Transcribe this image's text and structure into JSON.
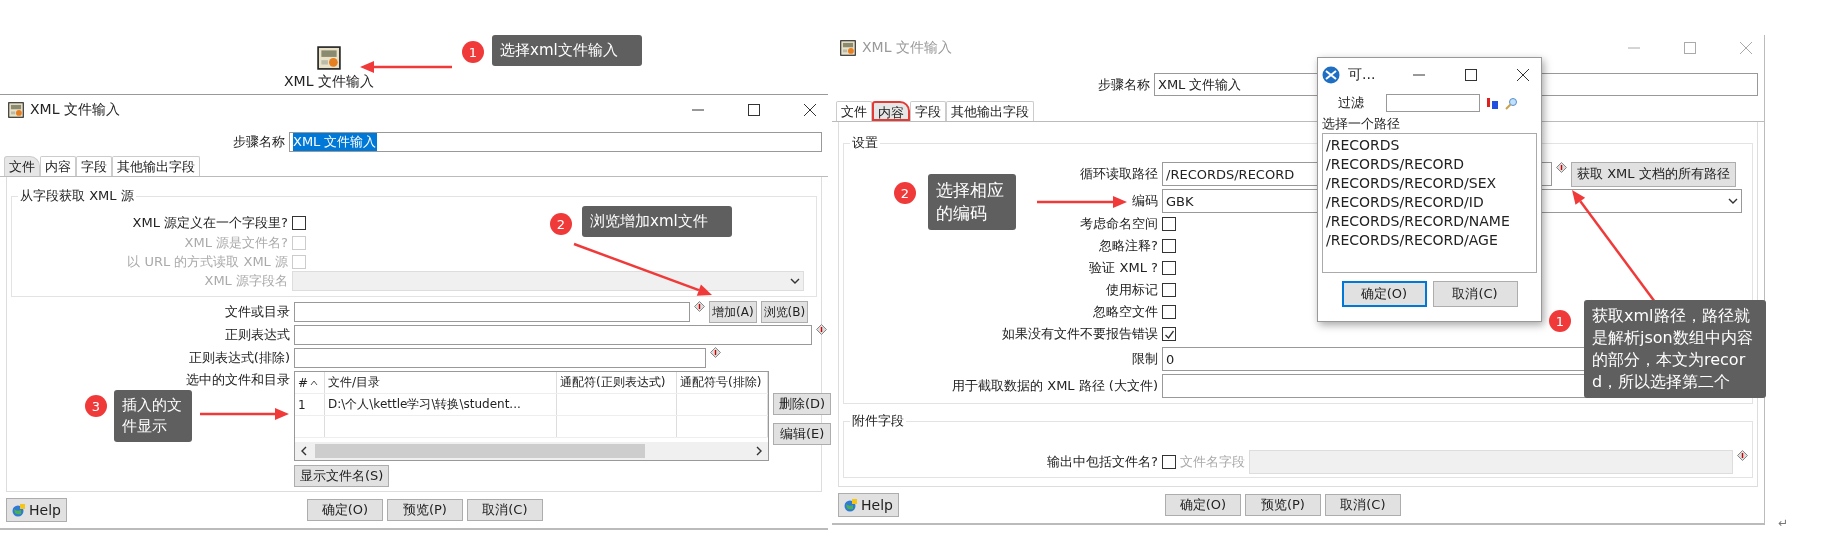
{
  "left": {
    "node": {
      "label": "XML 文件输入"
    },
    "dialog": {
      "title": "XML 文件输入",
      "active": true,
      "step_name": {
        "label": "步骤名称",
        "value": "XML 文件输入",
        "highlighted": true
      },
      "tabs": [
        {
          "label": "文件",
          "selected": true,
          "marked": false
        },
        {
          "label": "内容",
          "selected": false,
          "marked": false
        },
        {
          "label": "字段",
          "selected": false,
          "marked": false
        },
        {
          "label": "其他输出字段",
          "selected": false,
          "marked": false
        }
      ],
      "source_group": {
        "title": "从字段获取 XML 源",
        "options": [
          {
            "label": "XML 源定义在一个字段里?",
            "checked": false,
            "disabled": false
          },
          {
            "label": "XML 源是文件名?",
            "checked": false,
            "disabled": true
          },
          {
            "label": "以 URL 的方式读取 XML 源",
            "checked": false,
            "disabled": true
          }
        ],
        "field": {
          "label": "XML 源字段名",
          "disabled": true
        }
      },
      "file_row": {
        "label": "文件或目录",
        "buttons": [
          "增加(A)",
          "浏览(B)"
        ]
      },
      "regex": {
        "label": "正则表达式"
      },
      "regex_exclude": {
        "label": "正则表达式(排除)"
      },
      "selected_files": {
        "label": "选中的文件和目录",
        "columns": [
          "#",
          "文件/目录",
          "通配符(正则表达式)",
          "通配符号(排除)"
        ],
        "rows": [
          {
            "cells": [
              "1",
              "D:\\个人\\kettle学习\\转换\\student..."
            ]
          }
        ],
        "buttons": [
          "删除(D)",
          "编辑(E)"
        ]
      },
      "show_button": "显示文件名(S)",
      "help": "Help",
      "buttons": [
        "确定(O)",
        "预览(P)",
        "取消(C)"
      ]
    }
  },
  "right": {
    "dialog": {
      "title": "XML 文件输入",
      "active": false,
      "step_name": {
        "label": "步骤名称",
        "value": "XML 文件输入",
        "highlighted": false
      },
      "tabs": [
        {
          "label": "文件",
          "selected": false,
          "marked": false
        },
        {
          "label": "内容",
          "selected": true,
          "marked": true
        },
        {
          "label": "字段",
          "selected": false,
          "marked": false
        },
        {
          "label": "其他输出字段",
          "selected": false,
          "marked": false
        }
      ],
      "settings": {
        "title": "设置",
        "loop_path": {
          "label": "循环读取路径",
          "value": "/RECORDS/RECORD",
          "button": "获取 XML 文档的所有路径"
        },
        "encoding": {
          "label": "编码",
          "value": "GBK"
        },
        "options": [
          {
            "label": "考虑命名空间",
            "checked": false
          },
          {
            "label": "忽略注释?",
            "checked": false
          },
          {
            "label": "验证 XML ?",
            "checked": false
          },
          {
            "label": "使用标记",
            "checked": false
          },
          {
            "label": "忽略空文件",
            "checked": false
          },
          {
            "label": "如果没有文件不要报告错误",
            "checked": true
          }
        ],
        "limit": {
          "label": "限制",
          "value": "0"
        },
        "xml_path": {
          "label": "用于截取数据的 XML 路径 (大文件)"
        }
      },
      "extra": {
        "title": "附件字段",
        "include_filename": {
          "label": "输出中包括文件名?",
          "checked": false,
          "field_label": "文件名字段"
        }
      },
      "help": "Help",
      "buttons": [
        "确定(O)",
        "预览(P)",
        "取消(C)"
      ]
    }
  },
  "popup": {
    "title": "可...",
    "filter_label": "过滤",
    "list_label": "选择一个路径",
    "paths": [
      "/RECORDS",
      "/RECORDS/RECORD",
      "/RECORDS/RECORD/SEX",
      "/RECORDS/RECORD/ID",
      "/RECORDS/RECORD/NAME",
      "/RECORDS/RECORD/AGE"
    ],
    "buttons": [
      {
        "label": "确定(O)",
        "focused": true
      },
      {
        "label": "取消(C)",
        "focused": false
      }
    ]
  },
  "annotations": [
    {
      "number": "1",
      "text": "选择xml文件输入"
    },
    {
      "number": "2",
      "text": "浏览增加xml文件"
    },
    {
      "number": "3",
      "text": "插入的文件显示"
    },
    {
      "number": "2",
      "text": "选择相应的编码"
    },
    {
      "number": "1",
      "text": "获取xml路径，路径就是解析json数组中内容的部分，本文为record，所以选择第二个"
    }
  ],
  "return_mark": "↵"
}
